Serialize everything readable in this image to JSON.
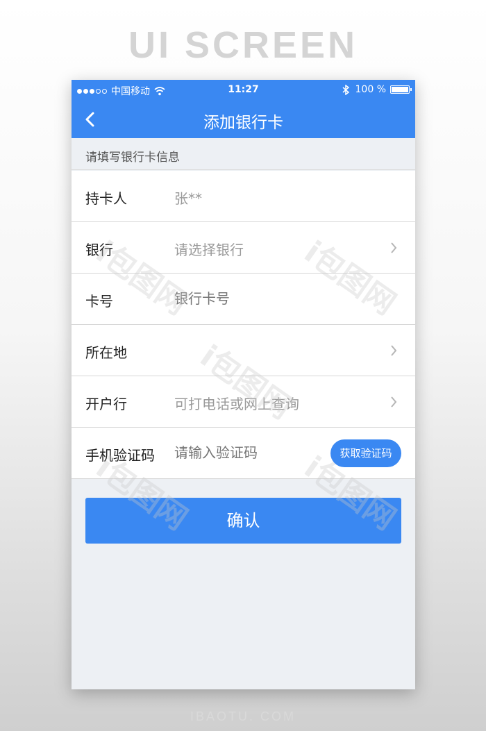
{
  "heading": "UI SCREEN",
  "footer": "IBAOTU. COM",
  "watermark": "i包图网",
  "status_bar": {
    "carrier": "中国移动",
    "time": "11:27",
    "battery_label": "100 %"
  },
  "nav": {
    "title": "添加银行卡"
  },
  "section_title": "请填写银行卡信息",
  "form": {
    "rows": [
      {
        "label": "持卡人",
        "value": "张**"
      },
      {
        "label": "银行",
        "placeholder": "请选择银行"
      },
      {
        "label": "卡号",
        "placeholder": "银行卡号"
      },
      {
        "label": "所在地",
        "value": ""
      },
      {
        "label": "开户行",
        "placeholder": "可打电话或网上查询"
      },
      {
        "label": "手机验证码",
        "placeholder": "请输入验证码",
        "action": "获取验证码"
      }
    ]
  },
  "confirm_label": "确认",
  "colors": {
    "primary": "#3a88f2",
    "background": "#edf0f4",
    "placeholder": "#9a9a9a"
  }
}
